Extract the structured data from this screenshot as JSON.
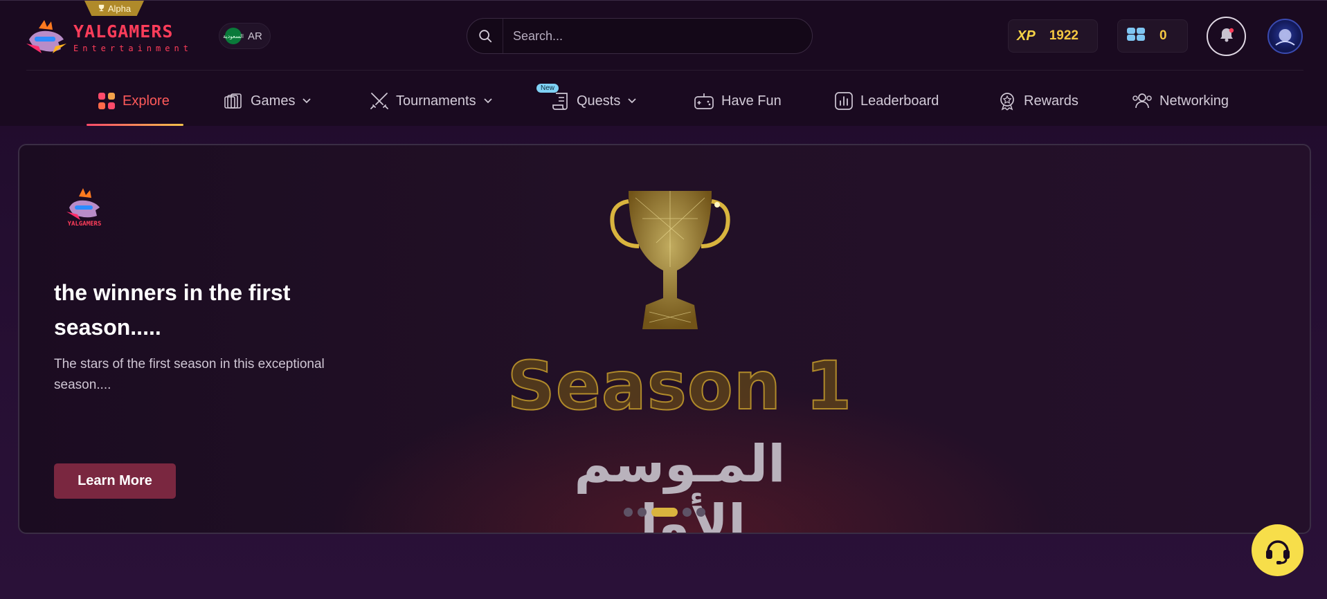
{
  "header": {
    "alpha_label": "Alpha",
    "logo": {
      "name": "YALGAMERS",
      "sub": "Entertainment"
    },
    "language": {
      "flag_text": "السعودية",
      "label": "AR"
    },
    "search": {
      "placeholder": "Search..."
    },
    "xp": {
      "badge": "XP",
      "value": "1922"
    },
    "gems": {
      "value": "0"
    }
  },
  "nav": {
    "items": [
      {
        "label": "Explore",
        "icon": "grid-icon",
        "active": true
      },
      {
        "label": "Games",
        "icon": "cards-icon",
        "dropdown": true
      },
      {
        "label": "Tournaments",
        "icon": "swords-icon",
        "dropdown": true
      },
      {
        "label": "Quests",
        "icon": "scroll-icon",
        "dropdown": true,
        "badge": "New"
      },
      {
        "label": "Have Fun",
        "icon": "gamepad-icon"
      },
      {
        "label": "Leaderboard",
        "icon": "bar-chart-icon"
      },
      {
        "label": "Rewards",
        "icon": "medal-icon"
      },
      {
        "label": "Networking",
        "icon": "people-icon"
      }
    ]
  },
  "banner": {
    "title": "the winners in the first season.....",
    "description": "The stars of the first season in this exceptional season....",
    "button_label": "Learn More",
    "season_en": "Season 1",
    "season_ar": "المـوسم الأول",
    "slides": 5,
    "active_slide": 3
  },
  "colors": {
    "accent_active": "#ff5a5a",
    "gold": "#f5c842",
    "button": "#7a2740",
    "support": "#f7de4a"
  }
}
